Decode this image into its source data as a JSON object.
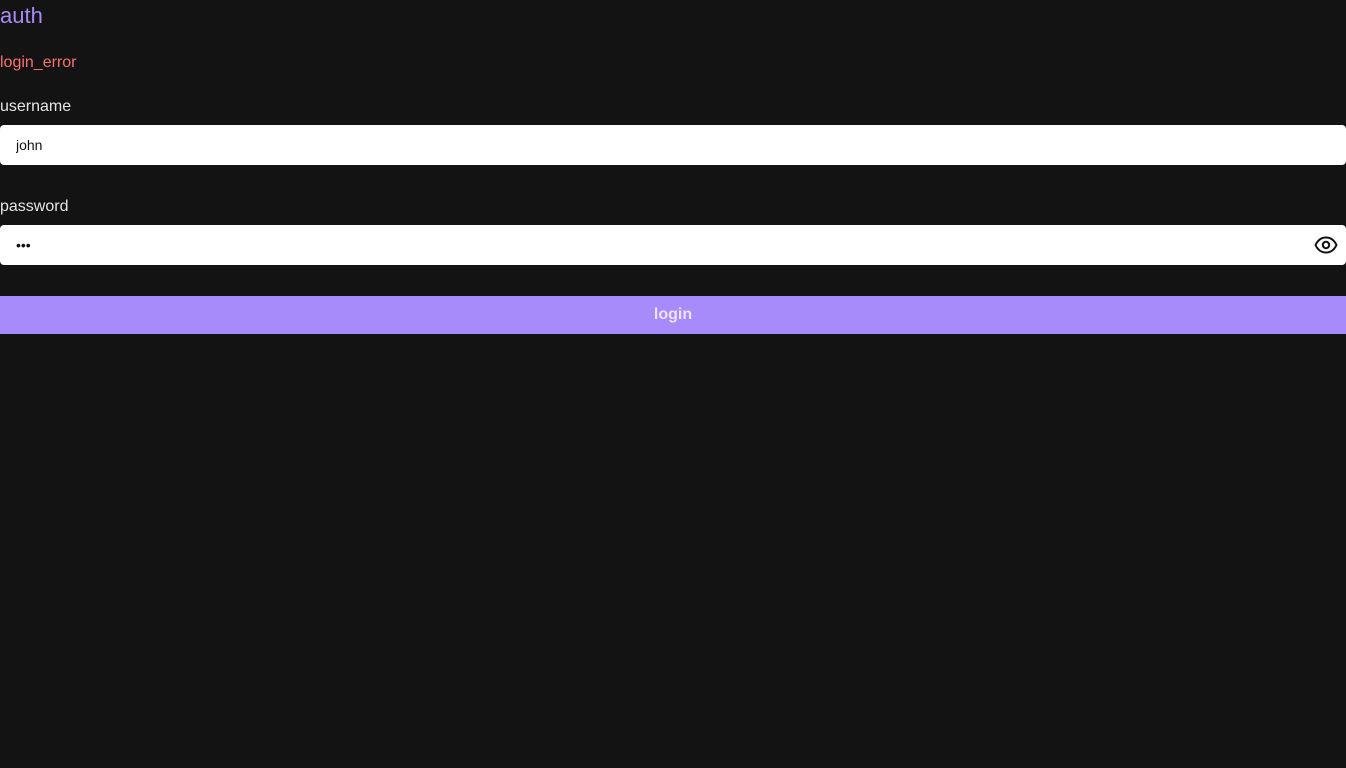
{
  "header": {
    "title": "auth"
  },
  "status": {
    "error_text": "login_error"
  },
  "form": {
    "username": {
      "label": "username",
      "value": "john"
    },
    "password": {
      "label": "password",
      "value": "abc",
      "toggle_icon": "eye-icon"
    },
    "submit_label": "login"
  },
  "colors": {
    "background": "#131313",
    "accent": "#a78bfa",
    "error": "#f87171",
    "text": "#e5e5e5"
  }
}
